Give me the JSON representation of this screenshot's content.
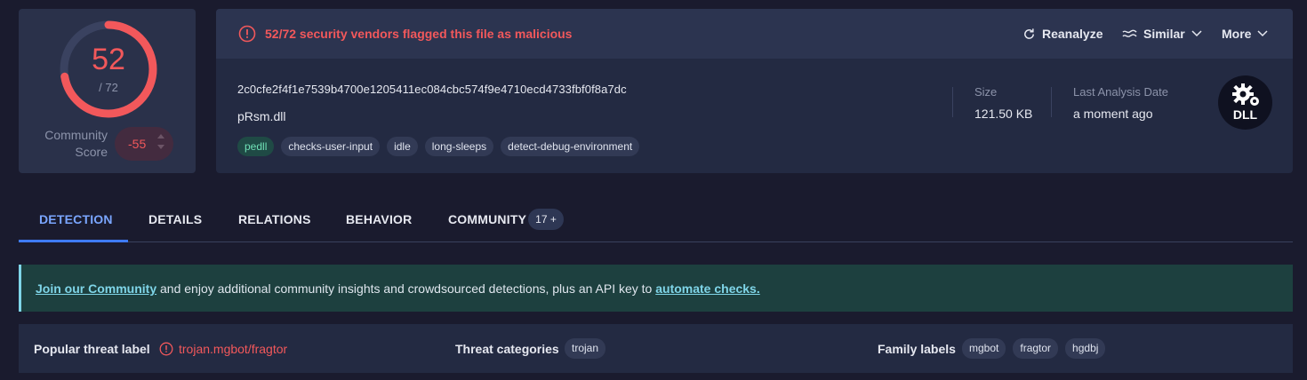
{
  "score": {
    "detected": "52",
    "total": "/ 72",
    "fraction": 0.7222,
    "community_label_line1": "Community",
    "community_label_line2": "Score",
    "community_value": "-55"
  },
  "alert": {
    "text": "52/72 security vendors flagged this file as malicious"
  },
  "actions": {
    "reanalyze": "Reanalyze",
    "similar": "Similar",
    "more": "More"
  },
  "file": {
    "hash": "2c0cfe2f4f1e7539b4700e1205411ec084cbc574f9e4710ecd4733fbf0f8a7dc",
    "name": "pRsm.dll",
    "tags": [
      "pedll",
      "checks-user-input",
      "idle",
      "long-sleeps",
      "detect-debug-environment"
    ],
    "size_label": "Size",
    "size_value": "121.50 KB",
    "date_label": "Last Analysis Date",
    "date_value": "a moment ago",
    "type_icon_text": "DLL"
  },
  "tabs": {
    "detection": "DETECTION",
    "details": "DETAILS",
    "relations": "RELATIONS",
    "behavior": "BEHAVIOR",
    "community": "COMMUNITY",
    "community_badge": "17 +"
  },
  "banner": {
    "link1": "Join our Community",
    "middle": " and enjoy additional community insights and crowdsourced detections, plus an API key to ",
    "link2": "automate checks."
  },
  "threat": {
    "popular_label": "Popular threat label",
    "popular_value": "trojan.mgbot/fragtor",
    "categories_label": "Threat categories",
    "categories": [
      "trojan"
    ],
    "family_label": "Family labels",
    "families": [
      "mgbot",
      "fragtor",
      "hgdbj"
    ]
  },
  "colors": {
    "danger": "#f2585b",
    "accent": "#3f7bff",
    "link": "#7fd5e8"
  }
}
